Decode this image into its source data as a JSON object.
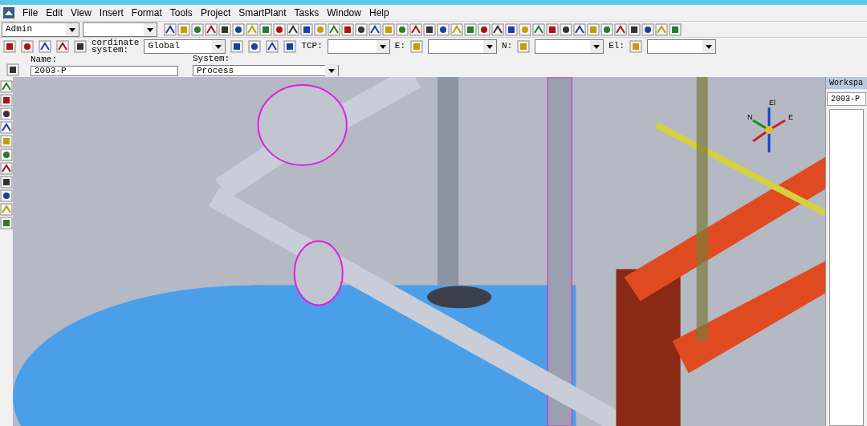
{
  "menu": [
    "File",
    "Edit",
    "View",
    "Insert",
    "Format",
    "Tools",
    "Project",
    "SmartPlant",
    "Tasks",
    "Window",
    "Help"
  ],
  "toolbar": {
    "permission_group": "Admin"
  },
  "locate_bar": {
    "coordinate_label_1": "cordinate",
    "coordinate_label_2": "system:",
    "coordinate_system": "Global",
    "tcp_label": "TCP:",
    "e_label": "E:",
    "n_label": "N:",
    "el_label": "El:"
  },
  "properties": {
    "name_label": "Name:",
    "name": "2003-P",
    "system_label": "System:",
    "system": "Process"
  },
  "compass": {
    "up": "El",
    "north": "N",
    "east": "E"
  },
  "workspace": {
    "title": "Workspa",
    "filter": "2003-P"
  }
}
